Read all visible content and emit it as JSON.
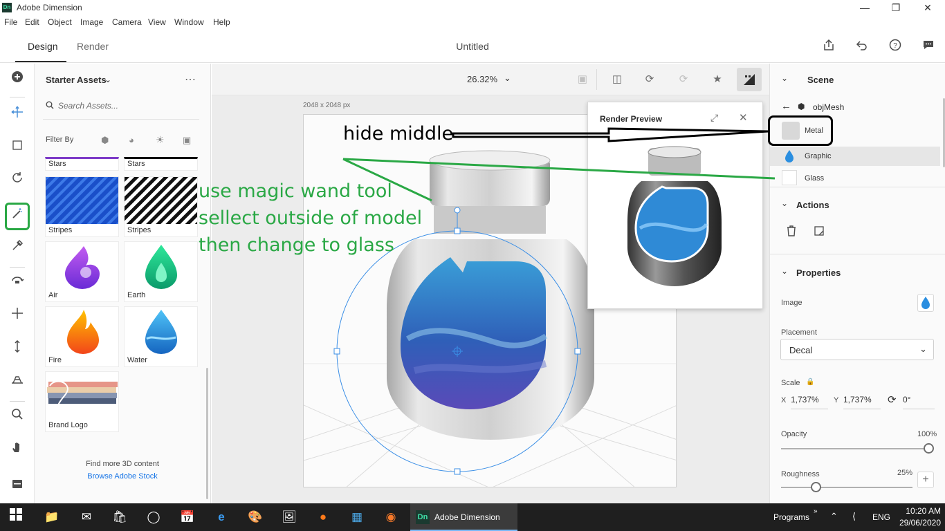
{
  "window": {
    "app_icon": "Dn",
    "title": "Adobe Dimension"
  },
  "menu": [
    "File",
    "Edit",
    "Object",
    "Image",
    "Camera",
    "View",
    "Window",
    "Help"
  ],
  "header": {
    "tabs": [
      "Design",
      "Render"
    ],
    "doc_title": "Untitled"
  },
  "assets": {
    "title": "Starter Assets",
    "search_placeholder": "Search Assets...",
    "filter_label": "Filter By",
    "items": [
      "Stars",
      "Stars",
      "Stripes",
      "Stripes",
      "Air",
      "Earth",
      "Fire",
      "Water",
      "Brand Logo"
    ],
    "find_more": "Find more 3D content",
    "browse_link": "Browse Adobe Stock"
  },
  "canvas": {
    "zoom": "26.32%",
    "size_label": "2048 x 2048 px",
    "render_preview_title": "Render Preview"
  },
  "scene": {
    "title": "Scene",
    "mesh_name": "objMesh",
    "materials": [
      "Metal",
      "Graphic",
      "Glass"
    ],
    "actions_title": "Actions",
    "properties_title": "Properties",
    "image_label": "Image",
    "placement_label": "Placement",
    "placement_value": "Decal",
    "scale_label": "Scale",
    "scale_x_label": "X",
    "scale_x": "1,737%",
    "scale_y_label": "Y",
    "scale_y": "1,737%",
    "rotation": "0°",
    "opacity_label": "Opacity",
    "opacity_value": "100%",
    "roughness_label": "Roughness",
    "roughness_value": "25%"
  },
  "annotations": {
    "hide_middle": "hide middle",
    "instruction_1": "use magic wand tool",
    "instruction_2": "sellect outside of model",
    "instruction_3": "then change to glass"
  },
  "taskbar": {
    "active_app": "Adobe Dimension",
    "programs": "Programs",
    "language": "ENG",
    "time": "10:20 AM",
    "date": "29/06/2020"
  },
  "colors": {
    "accent": "#1473e6",
    "annotation_green": "#2aa845",
    "taskbar": "#1f1f1f"
  }
}
